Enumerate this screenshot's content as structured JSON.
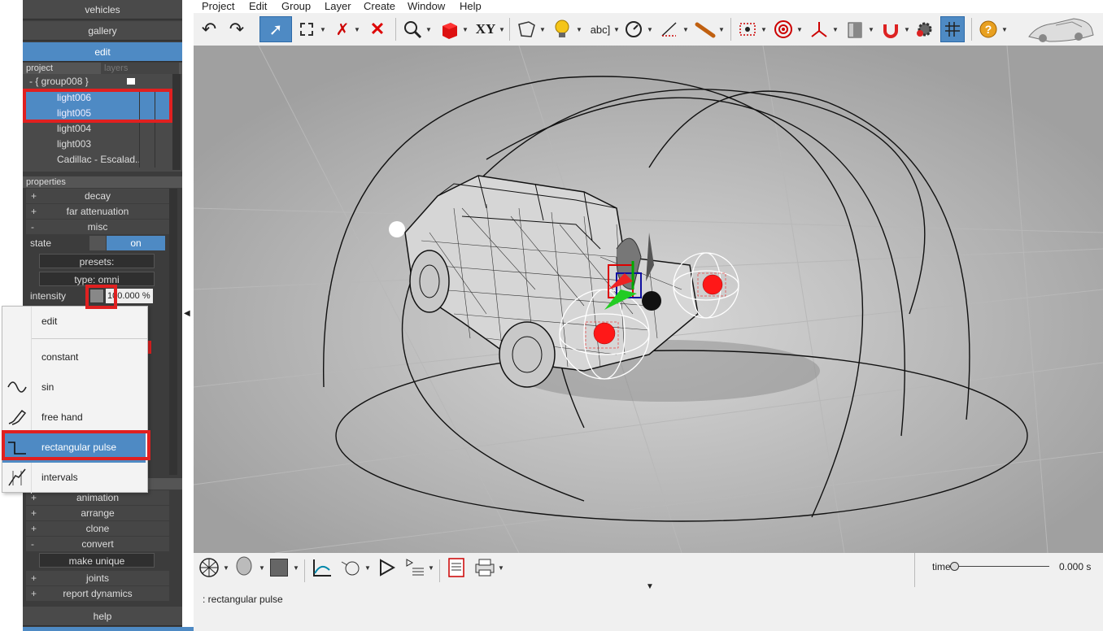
{
  "left_panel": {
    "top_buttons": [
      "vehicles",
      "gallery",
      "edit"
    ],
    "tabs": {
      "project": "project",
      "layers": "layers"
    },
    "tree": {
      "group": "- { group008 }",
      "items": [
        {
          "label": "light006",
          "selected": true
        },
        {
          "label": "light005",
          "selected": true
        },
        {
          "label": "light004",
          "selected": false
        },
        {
          "label": "light003",
          "selected": false
        },
        {
          "label": "Cadillac - Escalad..",
          "selected": false
        }
      ]
    },
    "properties_header": "properties",
    "sections": {
      "decay": "decay",
      "far_attenuation": "far attenuation",
      "misc": "misc",
      "animation": "animation",
      "arrange": "arrange",
      "clone": "clone",
      "convert": "convert",
      "joints": "joints",
      "report_dynamics": "report dynamics"
    },
    "plus_sign": "+",
    "minus_sign": "-",
    "state_label": "state",
    "state_value": "on",
    "presets_label": "presets:",
    "type_label": "type: omni",
    "intensity_label": "intensity",
    "intensity_value": "100.000 %",
    "make_unique": "make unique",
    "help": "help"
  },
  "popup_menu": {
    "items": [
      "edit",
      "constant",
      "sin",
      "free hand",
      "rectangular pulse",
      "intervals"
    ],
    "highlighted": "rectangular pulse"
  },
  "menubar": [
    "Project",
    "Edit",
    "Group",
    "Layer",
    "Create",
    "Window",
    "Help"
  ],
  "toolbar": {
    "xy_label": "XY",
    "abc_label": "abc]"
  },
  "timeline": {
    "label": "time",
    "value": "0.000 s"
  },
  "status_text": ": rectangular pulse",
  "colors": {
    "accent": "#4e8ac4",
    "highlight_box": "#e02020",
    "panel_bg": "#3c3c3c",
    "viewport_bg": "#b4b4b4"
  }
}
